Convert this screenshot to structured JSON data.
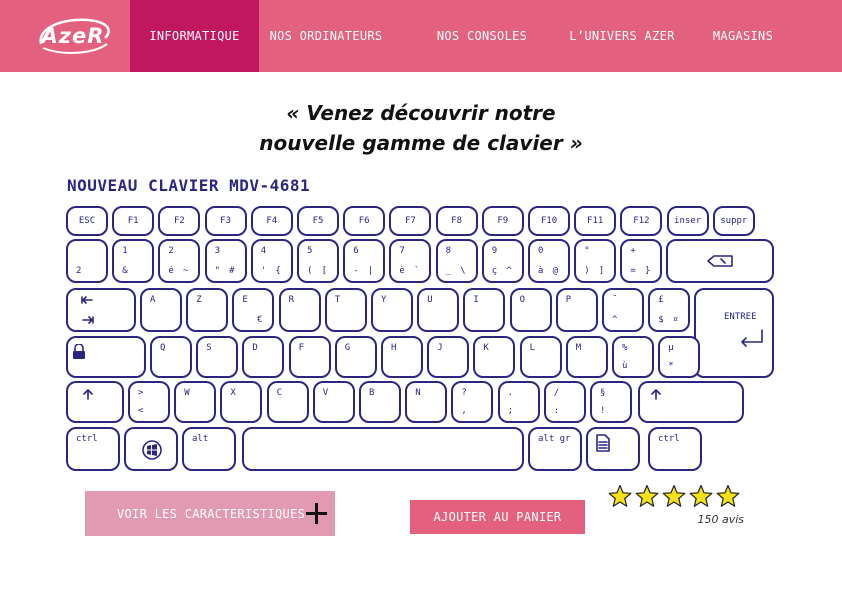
{
  "brand": {
    "logo_text": "AzeR"
  },
  "nav": {
    "items": [
      {
        "label": "INFORMATIQUE",
        "active": true
      },
      {
        "label": "NOS ORDINATEURS",
        "active": false
      },
      {
        "label": "NOS CONSOLES",
        "active": false
      },
      {
        "label": "L’UNIVERS AZER",
        "active": false
      },
      {
        "label": "MAGASINS",
        "active": false
      }
    ]
  },
  "hero": {
    "headline_line1": "« Venez découvrir notre",
    "headline_line2": "nouvelle gamme de clavier »"
  },
  "product": {
    "title": "NOUVEAU CLAVIER MDV-4681"
  },
  "keyboard": {
    "row1": [
      "ESC",
      "F1",
      "F2",
      "F3",
      "F4",
      "F5",
      "F6",
      "F7",
      "F8",
      "F9",
      "F10",
      "F11",
      "F12",
      "inser",
      "suppr"
    ],
    "row2": [
      {
        "bl": "2"
      },
      {
        "tl": "1",
        "bl": "&"
      },
      {
        "tl": "2",
        "bl": "é",
        "br": "~"
      },
      {
        "tl": "3",
        "bl": "\"",
        "br": "#"
      },
      {
        "tl": "4",
        "bl": "'",
        "br": "{"
      },
      {
        "tl": "5",
        "bl": "(",
        "br": "["
      },
      {
        "tl": "6",
        "bl": "-",
        "br": "|"
      },
      {
        "tl": "7",
        "bl": "è",
        "br": "`"
      },
      {
        "tl": "8",
        "bl": "_",
        "br": "\\"
      },
      {
        "tl": "9",
        "bl": "ç",
        "br": "^"
      },
      {
        "tl": "0",
        "bl": "à",
        "br": "@"
      },
      {
        "tl": "°",
        "bl": ")",
        "br": "]"
      },
      {
        "tl": "+",
        "bl": "=",
        "br": "}"
      }
    ],
    "row3": [
      {
        "tl": "A"
      },
      {
        "tl": "Z"
      },
      {
        "tl": "E",
        "br": "€"
      },
      {
        "tl": "R"
      },
      {
        "tl": "T"
      },
      {
        "tl": "Y"
      },
      {
        "tl": "U"
      },
      {
        "tl": "I"
      },
      {
        "tl": "O"
      },
      {
        "tl": "P"
      },
      {
        "tl": "¨",
        "bl": "^"
      },
      {
        "tl": "£",
        "bl": "$",
        "br": "¤"
      }
    ],
    "enter_label": "ENTREE",
    "row4": [
      {
        "tl": "Q"
      },
      {
        "tl": "S"
      },
      {
        "tl": "D"
      },
      {
        "tl": "F"
      },
      {
        "tl": "G"
      },
      {
        "tl": "H"
      },
      {
        "tl": "J"
      },
      {
        "tl": "K"
      },
      {
        "tl": "L"
      },
      {
        "tl": "M"
      },
      {
        "tl": "%",
        "bl": "ù"
      },
      {
        "tl": "µ",
        "bl": "*"
      }
    ],
    "row5": [
      {
        "tl": ">",
        "bl": "<"
      },
      {
        "tl": "W"
      },
      {
        "tl": "X"
      },
      {
        "tl": "C"
      },
      {
        "tl": "V"
      },
      {
        "tl": "B"
      },
      {
        "tl": "N"
      },
      {
        "tl": "?",
        "bl": ","
      },
      {
        "tl": ".",
        "bl": ";"
      },
      {
        "tl": "/",
        "bl": ":"
      },
      {
        "tl": "§",
        "bl": "!"
      }
    ],
    "ctrl_label": "ctrl",
    "alt_label": "alt",
    "altgr_label": "alt gr"
  },
  "actions": {
    "specs_label": "VOIR LES CARACTERISTIQUES",
    "cart_label": "AJOUTER AU PANIER"
  },
  "rating": {
    "stars": 5,
    "max": 5,
    "reviews_label": "150 avis",
    "star_color": "#f5e11a"
  },
  "colors": {
    "header": "#e4607f",
    "nav_active": "#c0175e",
    "keys": "#2c2682",
    "specs_button": "#e19ab2"
  }
}
